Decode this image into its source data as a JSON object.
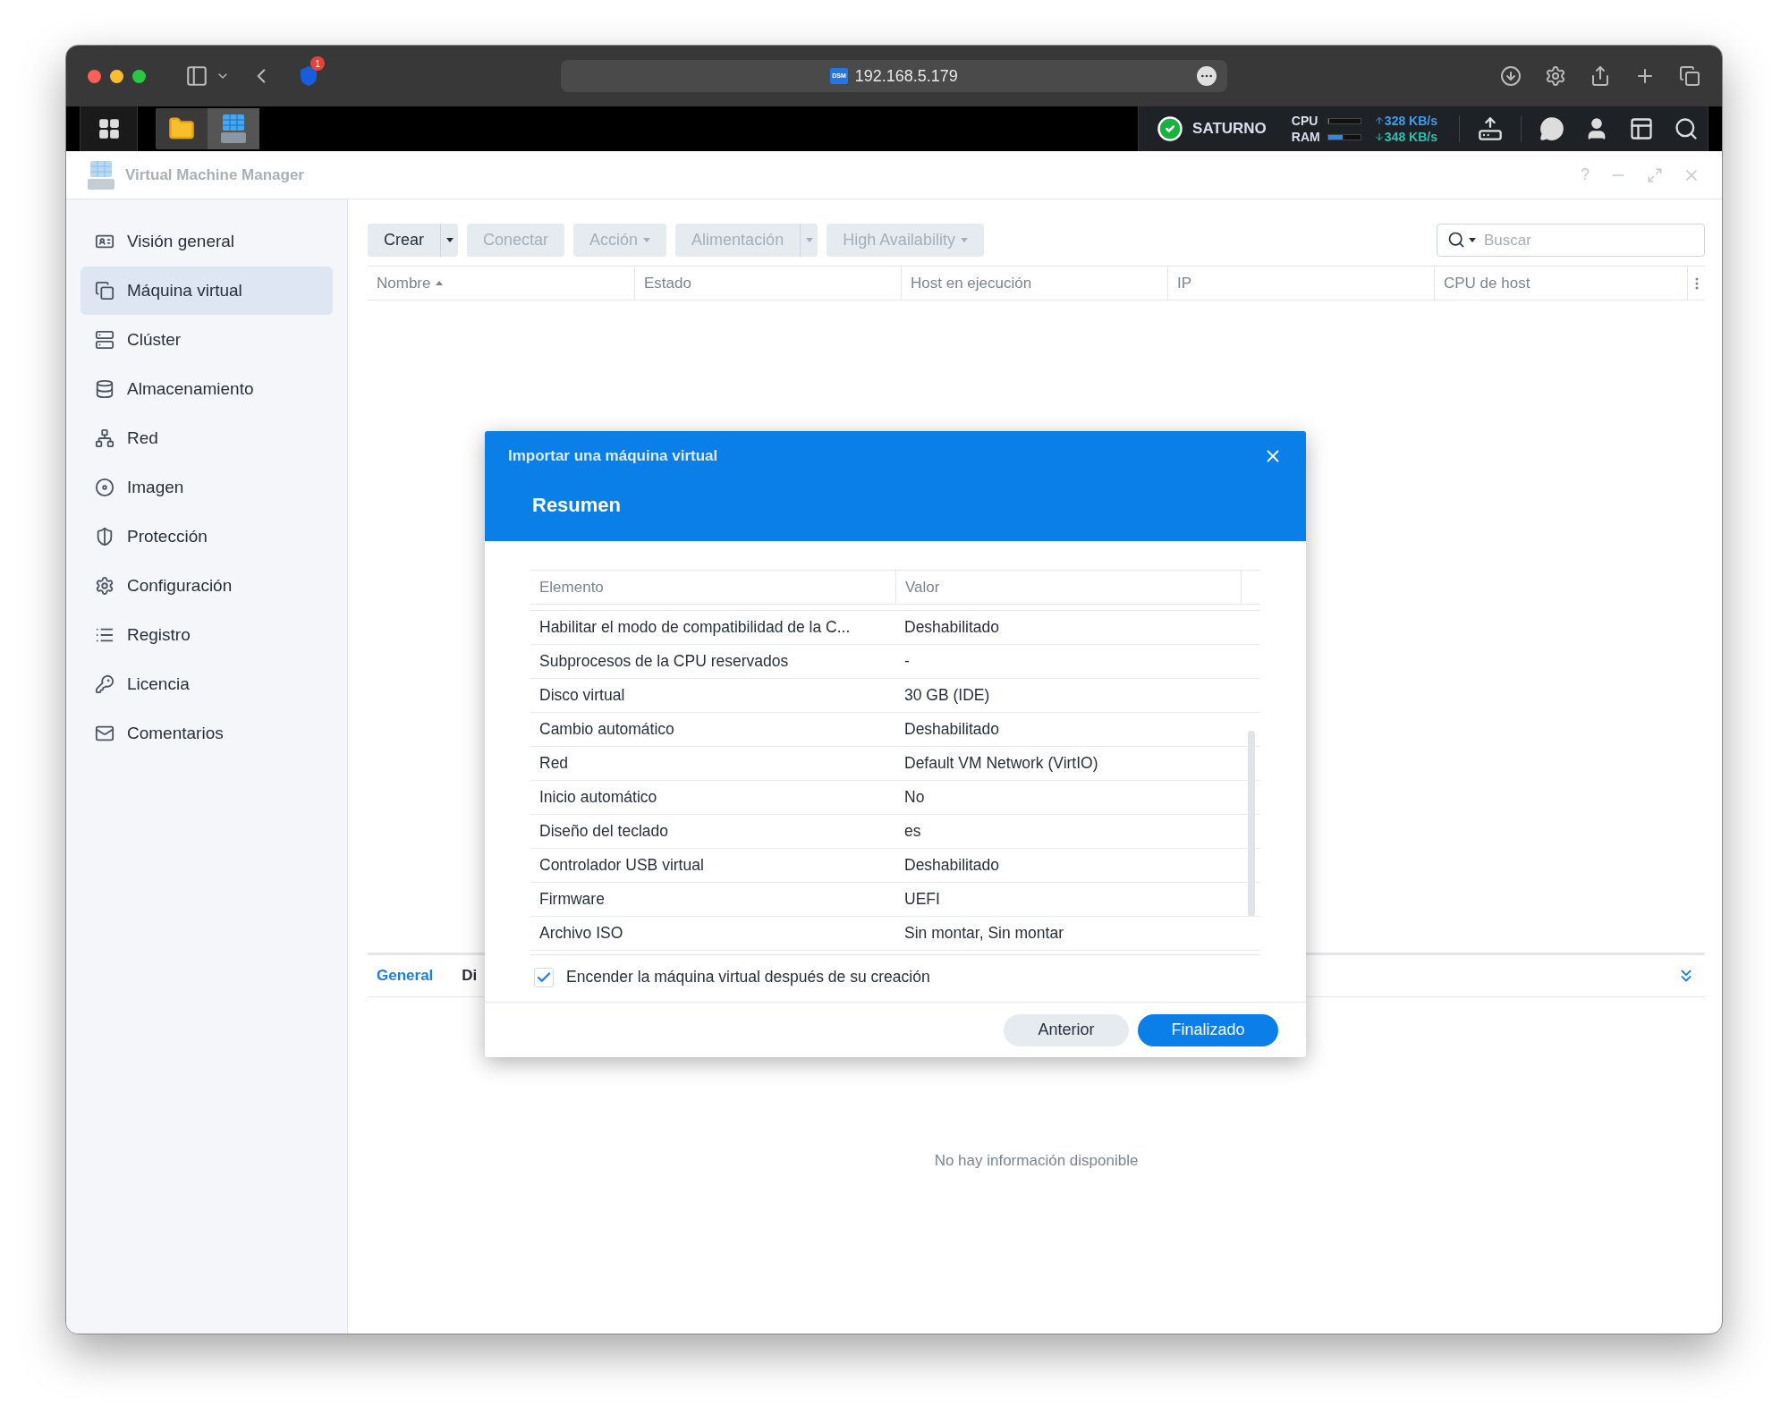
{
  "browser": {
    "notification_badge": "1",
    "site_icon_text": "DSM",
    "address": "192.168.5.179"
  },
  "taskbar": {
    "server_name": "SATURNO",
    "cpu": {
      "label": "CPU",
      "level": 0.04
    },
    "ram": {
      "label": "RAM",
      "level": 0.45
    },
    "upload_rate": "328 KB/s",
    "download_rate": "348 KB/s"
  },
  "app": {
    "title": "Virtual Machine Manager",
    "help": "?"
  },
  "sidebar": {
    "items": [
      {
        "label": "Visión general",
        "selected": false
      },
      {
        "label": "Máquina virtual",
        "selected": true
      },
      {
        "label": "Clúster",
        "selected": false
      },
      {
        "label": "Almacenamiento",
        "selected": false
      },
      {
        "label": "Red",
        "selected": false
      },
      {
        "label": "Imagen",
        "selected": false
      },
      {
        "label": "Protección",
        "selected": false
      },
      {
        "label": "Configuración",
        "selected": false
      },
      {
        "label": "Registro",
        "selected": false
      },
      {
        "label": "Licencia",
        "selected": false
      },
      {
        "label": "Comentarios",
        "selected": false
      }
    ]
  },
  "toolbar": {
    "buttons": [
      {
        "label": "Crear",
        "kind": "split",
        "disabled": false
      },
      {
        "label": "Conectar",
        "kind": "plain",
        "disabled": true
      },
      {
        "label": "Acción",
        "kind": "dropdown",
        "disabled": true
      },
      {
        "label": "Alimentación",
        "kind": "split",
        "disabled": true
      },
      {
        "label": "High Availability",
        "kind": "dropdown",
        "disabled": true
      }
    ],
    "search": {
      "placeholder": "Buscar"
    }
  },
  "table": {
    "columns": [
      {
        "label": "Nombre",
        "sorted": true
      },
      {
        "label": "Estado",
        "sorted": false
      },
      {
        "label": "Host en ejecución",
        "sorted": false
      },
      {
        "label": "IP",
        "sorted": false
      },
      {
        "label": "CPU de host",
        "sorted": false
      }
    ]
  },
  "detail": {
    "tabs": [
      {
        "label": "General",
        "selected": true
      },
      {
        "label": "Di",
        "selected": false
      }
    ],
    "empty_message": "No hay información disponible"
  },
  "dialog": {
    "title": "Importar una máquina virtual",
    "step": "Resumen",
    "columns": [
      "Elemento",
      "Valor"
    ],
    "rows": [
      {
        "item": "Habilitar el modo de compatibilidad de la C...",
        "value": "Deshabilitado"
      },
      {
        "item": "Subprocesos de la CPU reservados",
        "value": "-"
      },
      {
        "item": "Disco virtual",
        "value": "30 GB (IDE)"
      },
      {
        "item": "Cambio automático",
        "value": "Deshabilitado"
      },
      {
        "item": "Red",
        "value": "Default VM Network (VirtIO)"
      },
      {
        "item": "Inicio automático",
        "value": "No"
      },
      {
        "item": "Diseño del teclado",
        "value": "es"
      },
      {
        "item": "Controlador USB virtual",
        "value": "Deshabilitado"
      },
      {
        "item": "Firmware",
        "value": "UEFI"
      },
      {
        "item": "Archivo ISO",
        "value": "Sin montar, Sin montar"
      }
    ],
    "power_on": {
      "label": "Encender la máquina virtual después de su creación",
      "checked": true
    },
    "buttons": [
      {
        "label": "Anterior",
        "kind": "secondary"
      },
      {
        "label": "Finalizado",
        "kind": "primary"
      }
    ]
  }
}
